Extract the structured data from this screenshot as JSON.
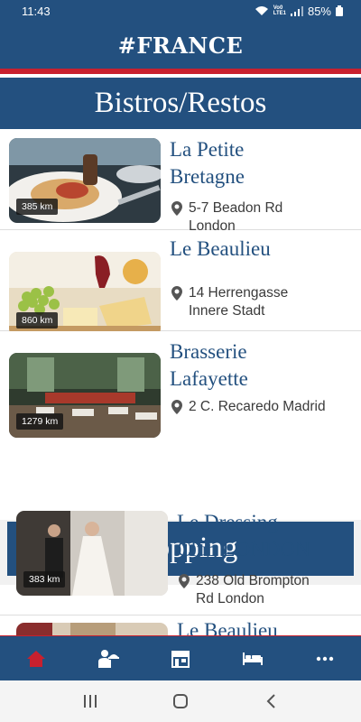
{
  "status_bar": {
    "time": "11:43",
    "carrier": "Vo0 LTE1",
    "battery": "85%"
  },
  "header": {
    "title": "#FRANCE"
  },
  "sections": [
    {
      "title": "Bistros/Restos",
      "items": [
        {
          "name": "La Petite\nBretagne",
          "distance": "385 km",
          "address": "5-7 Beadon Rd\nLondon"
        },
        {
          "name": "Le Beaulieu",
          "distance": "860 km",
          "address": "14 Herrengasse\nInnere Stadt"
        },
        {
          "name": "Brasserie\nLafayette",
          "distance": "1279 km",
          "address": "2 C. Recaredo Madrid"
        }
      ]
    },
    {
      "title": "Shopping",
      "items": [
        {
          "name": "Le Dressing\nClub LONDON",
          "distance": "383 km",
          "address": "238 Old Brompton\nRd London"
        },
        {
          "name": "Le Beaulieu",
          "distance": "",
          "address": ""
        }
      ]
    }
  ],
  "bottom_nav": [
    {
      "icon": "home-icon",
      "active": true
    },
    {
      "icon": "waiter-icon",
      "active": false
    },
    {
      "icon": "shop-icon",
      "active": false
    },
    {
      "icon": "bed-icon",
      "active": false
    },
    {
      "icon": "more-icon",
      "active": false
    }
  ],
  "colors": {
    "primary": "#23507f",
    "accent": "#c8202e",
    "text": "#3a3a3a"
  }
}
